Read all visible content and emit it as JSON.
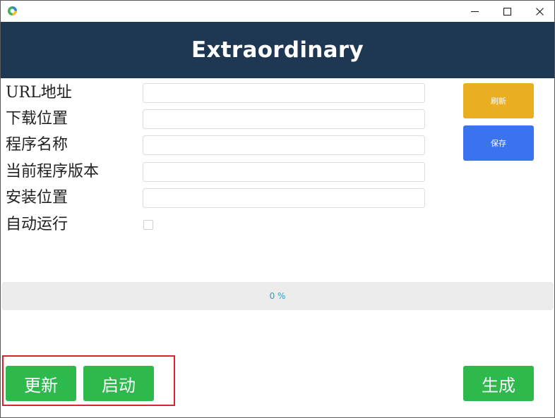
{
  "titlebar": {
    "icon": "app-logo-icon",
    "minimize_icon": "minimize-icon",
    "maximize_icon": "maximize-icon",
    "close_icon": "close-icon"
  },
  "header": {
    "title": "Extraordinary",
    "background": "#1e3753"
  },
  "form": {
    "url_label": "URL地址",
    "url_value": "",
    "download_location_label": "下载位置",
    "download_location_value": "",
    "program_name_label": "程序名称",
    "program_name_value": "",
    "current_version_label": "当前程序版本",
    "current_version_value": "",
    "install_location_label": "安装位置",
    "install_location_value": "",
    "auto_run_label": "自动运行",
    "auto_run_checked": false
  },
  "side_buttons": {
    "refresh_label": "刷新",
    "refresh_color": "#e9ae22",
    "save_label": "保存",
    "save_color": "#3a73f0"
  },
  "progress": {
    "value_percent": 0,
    "text": "0 %"
  },
  "bottom_buttons": {
    "update_label": "更新",
    "launch_label": "启动",
    "generate_label": "生成",
    "color": "#2eb94d"
  }
}
